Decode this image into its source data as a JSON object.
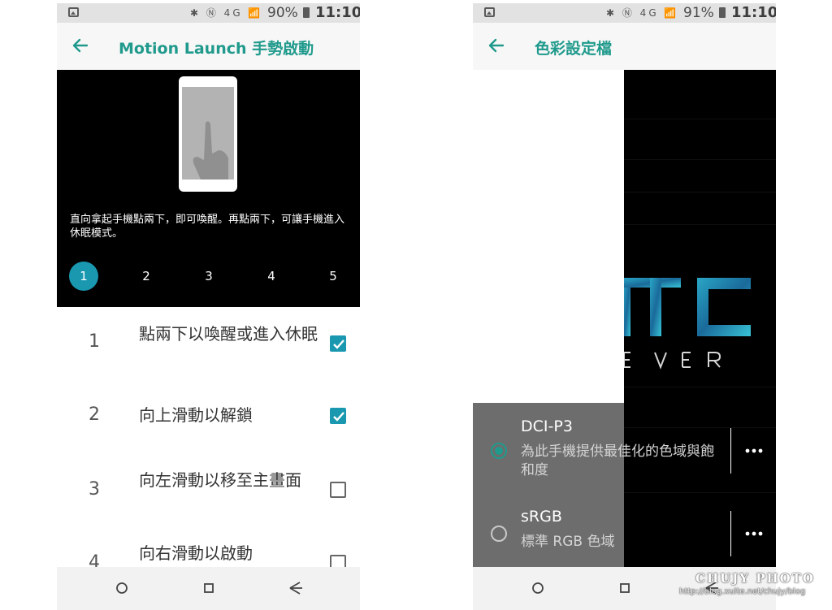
{
  "left_screen": {
    "status": {
      "icons": "✱ Ⓝ 4G 📶",
      "battery": "90%",
      "time": "11:10"
    },
    "appbar": {
      "title": "Motion Launch 手勢啟動"
    },
    "demo": {
      "caption": "直向拿起手機點兩下，即可喚醒。再點兩下，可讓手機進入休眠模式。",
      "steps": [
        "1",
        "2",
        "3",
        "4",
        "5"
      ],
      "active_step": "1"
    },
    "gestures": [
      {
        "num": "1",
        "label": "點兩下以喚醒或進入休眠",
        "checked": true
      },
      {
        "num": "2",
        "label": "向上滑動以解鎖",
        "checked": true
      },
      {
        "num": "3",
        "label": "向左滑動以移至主畫面",
        "checked": false
      },
      {
        "num": "4",
        "label": "向右滑動以啟動",
        "checked": false
      }
    ]
  },
  "right_screen": {
    "status": {
      "icons": "✱ Ⓝ 4G 📶",
      "battery": "91%",
      "time": "11:10"
    },
    "appbar": {
      "title": "色彩設定檔"
    },
    "options": [
      {
        "name": "DCI-P3",
        "description": "為此手機提供最佳化的色域與飽和度",
        "selected": true
      },
      {
        "name": "sRGB",
        "description": "標準 RGB 色域",
        "selected": false
      }
    ]
  },
  "watermark": {
    "title": "CHUJY PHOTO",
    "url": "http://blog.xuite.net/chujy/blog"
  },
  "colors": {
    "accent_teal": "#1f9a8c",
    "step_blue": "#1a98b0",
    "dialog_grey": "#6d6d6d"
  }
}
